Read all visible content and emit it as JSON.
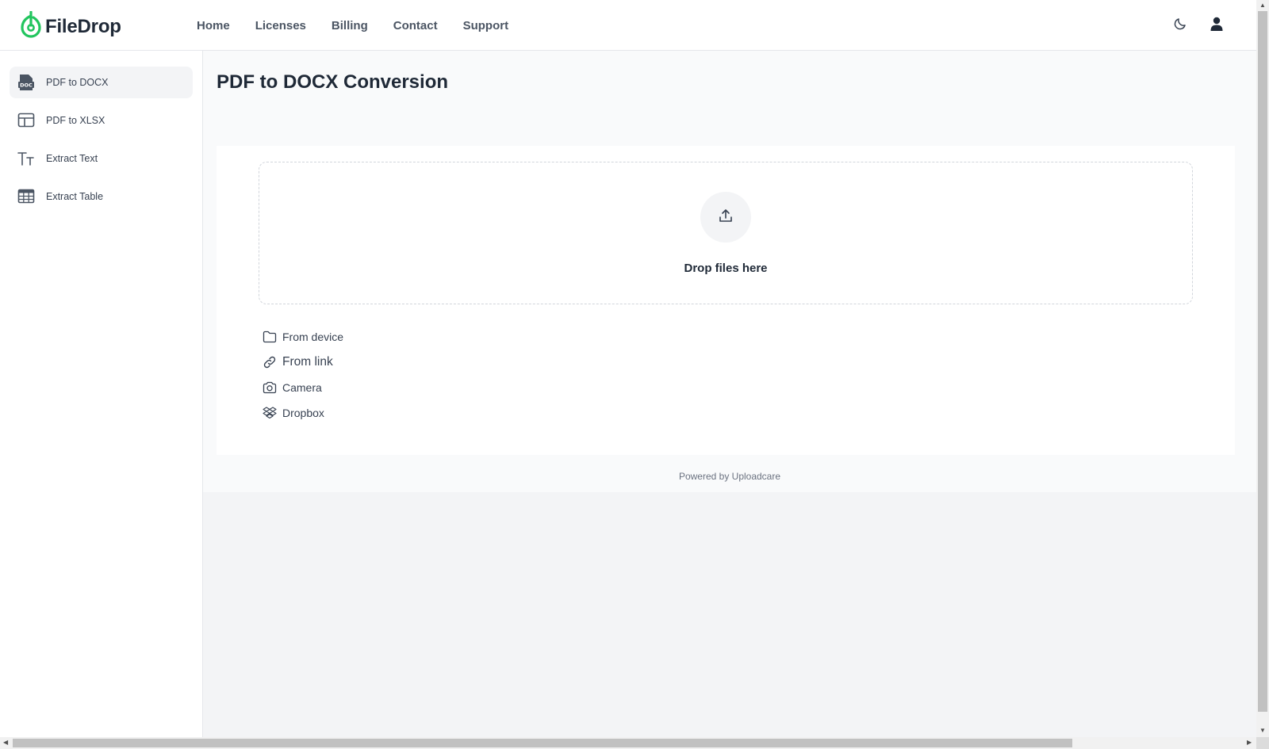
{
  "app": {
    "name": "FileDrop",
    "brand_color": "#22c55e"
  },
  "nav": {
    "items": [
      {
        "label": "Home"
      },
      {
        "label": "Licenses"
      },
      {
        "label": "Billing"
      },
      {
        "label": "Contact"
      },
      {
        "label": "Support"
      }
    ]
  },
  "header_actions": {
    "theme_icon": "moon-icon",
    "account_icon": "user-icon"
  },
  "sidebar": {
    "items": [
      {
        "label": "PDF to DOCX",
        "icon": "doc-file-icon",
        "active": true
      },
      {
        "label": "PDF to XLSX",
        "icon": "layout-table-icon",
        "active": false
      },
      {
        "label": "Extract Text",
        "icon": "text-size-icon",
        "active": false
      },
      {
        "label": "Extract Table",
        "icon": "table-icon",
        "active": false
      }
    ]
  },
  "main": {
    "title": "PDF to DOCX Conversion",
    "dropzone": {
      "text": "Drop files here",
      "icon": "upload-icon"
    },
    "sources": [
      {
        "label": "From device",
        "icon": "folder-icon"
      },
      {
        "label": "From link",
        "icon": "link-icon"
      },
      {
        "label": "Camera",
        "icon": "camera-icon"
      },
      {
        "label": "Dropbox",
        "icon": "dropbox-icon"
      }
    ],
    "powered_by": "Powered by Uploadcare"
  }
}
